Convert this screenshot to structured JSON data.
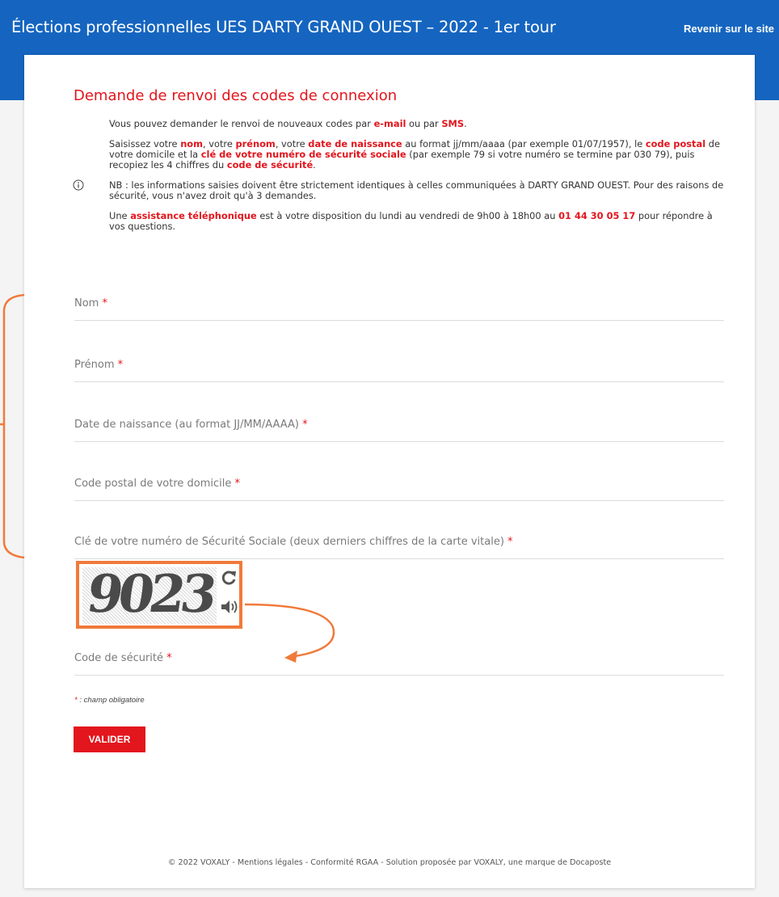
{
  "header": {
    "title": "Élections professionnelles UES DARTY GRAND OUEST – 2022 - 1er tour",
    "back_link": "Revenir sur le site",
    "color": "#1565c0"
  },
  "form": {
    "heading": "Demande de renvoi des codes de connexion",
    "info": {
      "p1": [
        "Vous pouvez demander le renvoi de nouveaux codes par ",
        "e-mail",
        " ou par ",
        "SMS",
        "."
      ],
      "p2": [
        "Saisissez votre ",
        "nom",
        ", votre ",
        "prénom",
        ", votre ",
        "date de naissance",
        " au format jj/mm/aaaa (par exemple 01/07/1957), le ",
        "code postal",
        " de votre domicile et la ",
        "clé de votre numéro de sécurité sociale",
        " (par exemple 79 si votre numéro se termine par 030 79), puis recopiez les 4 chiffres du ",
        "code de sécurité",
        "."
      ],
      "p3": "NB : les informations saisies doivent être strictement identiques à celles communiquées à DARTY GRAND OUEST. Pour des raisons de sécurité, vous n'avez droit qu'à 3 demandes.",
      "p4": [
        "Une ",
        "assistance téléphonique",
        " est à votre disposition du lundi au vendredi de 9h00 à 18h00 au ",
        "01 44 30 05 17",
        " pour répondre à vos questions."
      ]
    },
    "fields": {
      "nom": "Nom",
      "prenom": "Prénom",
      "birthdate": "Date de naissance (au format JJ/MM/AAAA)",
      "postal": "Code postal de votre domicile",
      "ssn_key": "Clé de votre numéro de Sécurité Sociale (deux derniers chiffres de la carte vitale)",
      "security_code": "Code de sécurité"
    },
    "required_mark": "*",
    "captcha": {
      "digits": "9023",
      "refresh_icon": "refresh-icon",
      "audio_icon": "speaker-icon"
    },
    "mandatory_note": " : champ obligatoire",
    "submit_label": "VALIDER",
    "accent": "#e3151d"
  },
  "footer": {
    "text": "© 2022 VOXALY - Mentions légales - Conformité RGAA - Solution proposée par VOXALY, une marque de Docaposte"
  },
  "annotation_color": "#f07a3a"
}
